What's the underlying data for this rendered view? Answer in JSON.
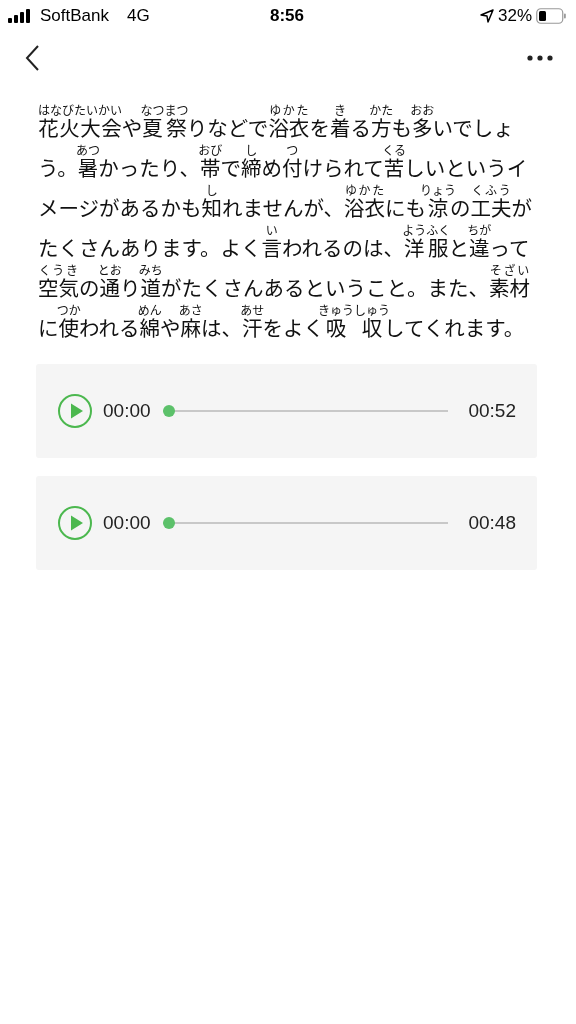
{
  "status_bar": {
    "carrier": "SoftBank",
    "network": "4G",
    "time": "8:56",
    "battery": "32%"
  },
  "article": {
    "lines": [
      [
        {
          "t": "花火大会",
          "r": "はなびたいかい"
        },
        {
          "t": "や"
        },
        {
          "t": "夏祭",
          "r": "なつまつ"
        },
        {
          "t": "りなどで"
        },
        {
          "t": "浴衣",
          "r": "ゆかた"
        },
        {
          "t": "を"
        },
        {
          "t": "着",
          "r": "き"
        },
        {
          "t": "る"
        },
        {
          "t": "方",
          "r": "かた"
        },
        {
          "t": "も"
        },
        {
          "t": "多",
          "r": "おお"
        },
        {
          "t": "いでしょ"
        }
      ],
      [
        {
          "t": "う。"
        },
        {
          "t": "暑",
          "r": "あつ"
        },
        {
          "t": "かったり、"
        },
        {
          "t": "帯",
          "r": "おび"
        },
        {
          "t": "で"
        },
        {
          "t": "締",
          "r": "し"
        },
        {
          "t": "め"
        },
        {
          "t": "付",
          "r": "つ"
        },
        {
          "t": "けられて"
        },
        {
          "t": "苦",
          "r": "くる"
        },
        {
          "t": "しいというイ"
        }
      ],
      [
        {
          "t": "メージがあるかも"
        },
        {
          "t": "知",
          "r": "し"
        },
        {
          "t": "れませんが、"
        },
        {
          "t": "浴衣",
          "r": "ゆかた"
        },
        {
          "t": "にも"
        },
        {
          "t": "涼",
          "r": "りょう"
        },
        {
          "t": "の"
        },
        {
          "t": "工夫",
          "r": "くふう"
        },
        {
          "t": "が"
        }
      ],
      [
        {
          "t": "たくさんあります。よく"
        },
        {
          "t": "言",
          "r": "い"
        },
        {
          "t": "われるのは、"
        },
        {
          "t": "洋服",
          "r": "ようふく"
        },
        {
          "t": "と"
        },
        {
          "t": "違",
          "r": "ちが"
        },
        {
          "t": "って"
        }
      ],
      [
        {
          "t": "空気",
          "r": "くうき"
        },
        {
          "t": "の"
        },
        {
          "t": "通",
          "r": "とお"
        },
        {
          "t": "り"
        },
        {
          "t": "道",
          "r": "みち"
        },
        {
          "t": "がたくさんあるということ。また、"
        },
        {
          "t": "素材",
          "r": "そざい"
        }
      ],
      [
        {
          "t": "に"
        },
        {
          "t": "使",
          "r": "つか"
        },
        {
          "t": "われる"
        },
        {
          "t": "綿",
          "r": "めん"
        },
        {
          "t": "や"
        },
        {
          "t": "麻",
          "r": "あさ"
        },
        {
          "t": "は、"
        },
        {
          "t": "汗",
          "r": "あせ"
        },
        {
          "t": "をよく"
        },
        {
          "t": "吸収",
          "r": "きゅうしゅう"
        },
        {
          "t": "してくれます。"
        }
      ]
    ]
  },
  "players": [
    {
      "current": "00:00",
      "duration": "00:52",
      "level": 0
    },
    {
      "current": "00:00",
      "duration": "00:48",
      "level": 0
    }
  ]
}
